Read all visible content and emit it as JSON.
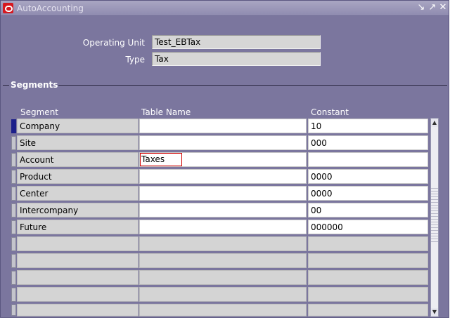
{
  "window": {
    "title": "AutoAccounting"
  },
  "header": {
    "operating_unit_label": "Operating Unit",
    "operating_unit_value": "Test_EBTax",
    "type_label": "Type",
    "type_value": "Tax"
  },
  "segments": {
    "section_title": "Segments",
    "columns": {
      "segment": "Segment",
      "table_name": "Table Name",
      "constant": "Constant"
    },
    "rows": [
      {
        "segment": "Company",
        "table_name": "",
        "constant": "10"
      },
      {
        "segment": "Site",
        "table_name": "",
        "constant": "000"
      },
      {
        "segment": "Account",
        "table_name": "Taxes",
        "constant": ""
      },
      {
        "segment": "Product",
        "table_name": "",
        "constant": "0000"
      },
      {
        "segment": "Center",
        "table_name": "",
        "constant": "0000"
      },
      {
        "segment": "Intercompany",
        "table_name": "",
        "constant": "00"
      },
      {
        "segment": "Future",
        "table_name": "",
        "constant": "000000"
      }
    ]
  }
}
